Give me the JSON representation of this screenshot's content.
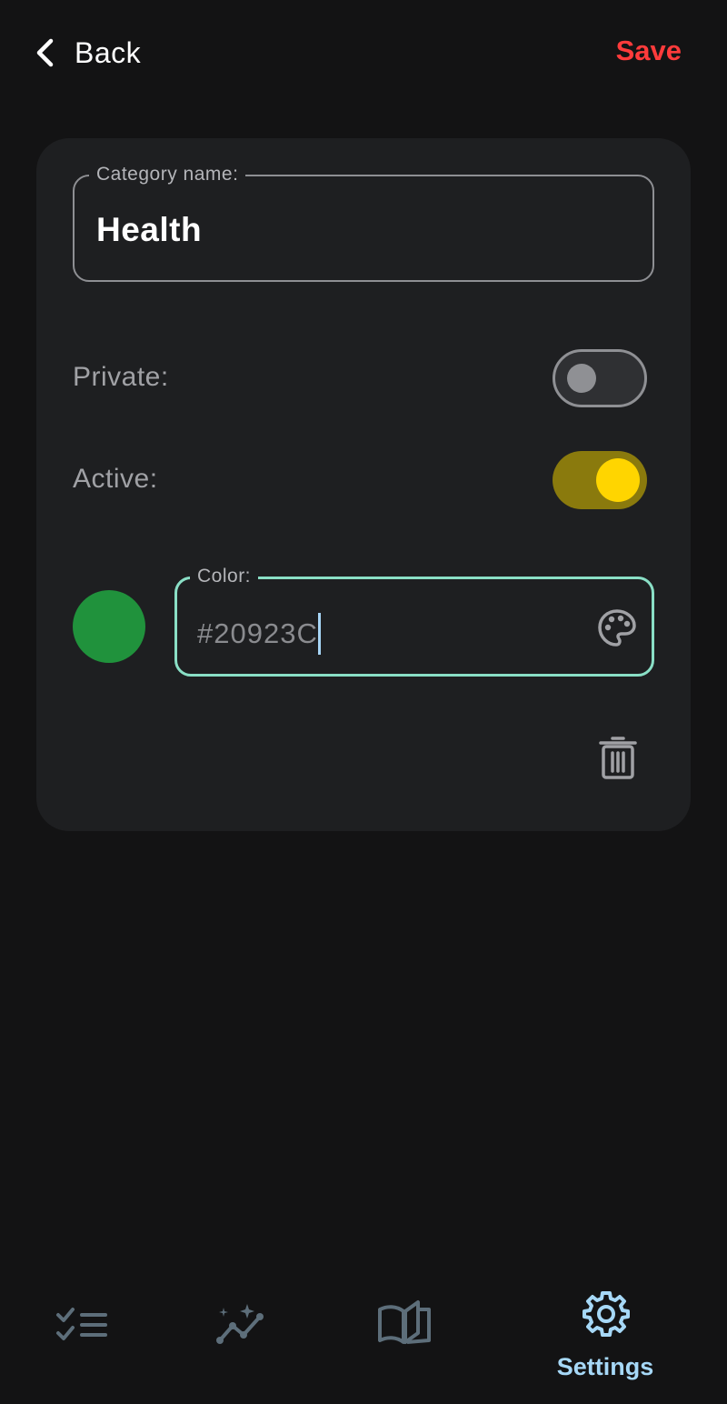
{
  "header": {
    "back_label": "Back",
    "save_label": "Save"
  },
  "form": {
    "name_field": {
      "label": "Category name:",
      "value": "Health"
    },
    "private": {
      "label": "Private:",
      "enabled": false
    },
    "active": {
      "label": "Active:",
      "enabled": true
    },
    "color_field": {
      "label": "Color:",
      "value": "#20923C",
      "swatch_color": "#20923C"
    }
  },
  "nav": {
    "items": [
      {
        "icon": "task-list-icon",
        "label": "",
        "active": false
      },
      {
        "icon": "insights-icon",
        "label": "",
        "active": false
      },
      {
        "icon": "journal-book-icon",
        "label": "",
        "active": false
      },
      {
        "icon": "gear-icon",
        "label": "Settings",
        "active": true
      }
    ]
  },
  "colors": {
    "accent_save": "#FF3B3B",
    "toggle_on_knob": "#FFD500",
    "focus_border": "#8ADFC6",
    "nav_active": "#A6D8F7"
  }
}
